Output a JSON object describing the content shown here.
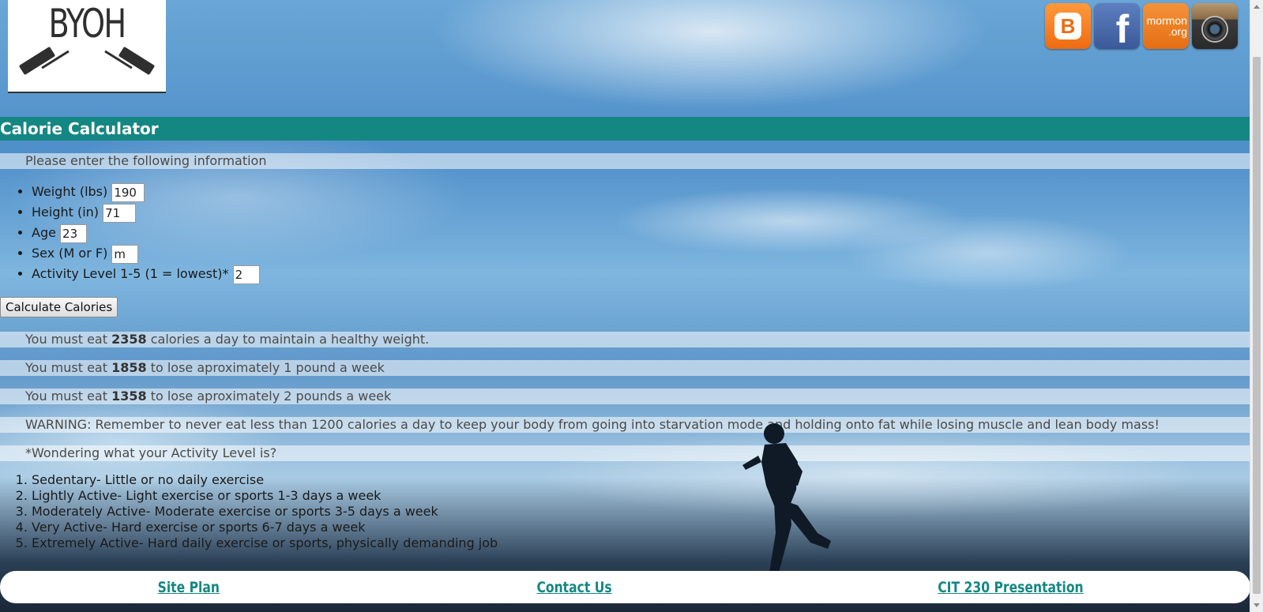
{
  "logo": {
    "text": "BYOH"
  },
  "social": [
    {
      "name": "blogger-icon",
      "glyph": "B"
    },
    {
      "name": "facebook-icon",
      "glyph": "f"
    },
    {
      "name": "mormon-org-icon",
      "line1": "mormon",
      "line2": ".org"
    },
    {
      "name": "instagram-icon"
    }
  ],
  "header": {
    "title": "Calorie Calculator"
  },
  "intro": "Please enter the following information",
  "form": {
    "weight": {
      "label": "Weight (lbs)",
      "value": "190"
    },
    "height": {
      "label": "Height (in)",
      "value": "71"
    },
    "age": {
      "label": "Age",
      "value": "23"
    },
    "sex": {
      "label": "Sex (M or F)",
      "value": "m"
    },
    "activity": {
      "label": "Activity Level 1-5 (1 = lowest)*",
      "value": "2"
    },
    "submit_label": "Calculate Calories"
  },
  "results": {
    "maintain": {
      "prefix": "You must eat ",
      "value": "2358",
      "suffix": " calories a day to maintain a healthy weight."
    },
    "lose1": {
      "prefix": "You must eat ",
      "value": "1858",
      "suffix": " to lose aproximately 1 pound a week"
    },
    "lose2": {
      "prefix": "You must eat ",
      "value": "1358",
      "suffix": " to lose aproximately 2 pounds a week"
    },
    "warning": "WARNING: Remember to never eat less than 1200 calories a day to keep your body from going into starvation mode and holding onto fat while losing muscle and lean body mass!",
    "activity_question": "*Wondering what your Activity Level is?"
  },
  "activity_levels": [
    "Sedentary- Little or no daily exercise",
    "Lightly Active- Light exercise or sports 1-3 days a week",
    "Moderately Active- Moderate exercise or sports 3-5 days a week",
    "Very Active- Hard exercise or sports 6-7 days a week",
    "Extremely Active- Hard daily exercise or sports, physically demanding job"
  ],
  "footer": {
    "site_plan": "Site Plan",
    "contact_us": "Contact Us",
    "presentation": "CIT 230 Presentation"
  },
  "colors": {
    "accent": "#158783",
    "header_text": "#ffffff"
  }
}
